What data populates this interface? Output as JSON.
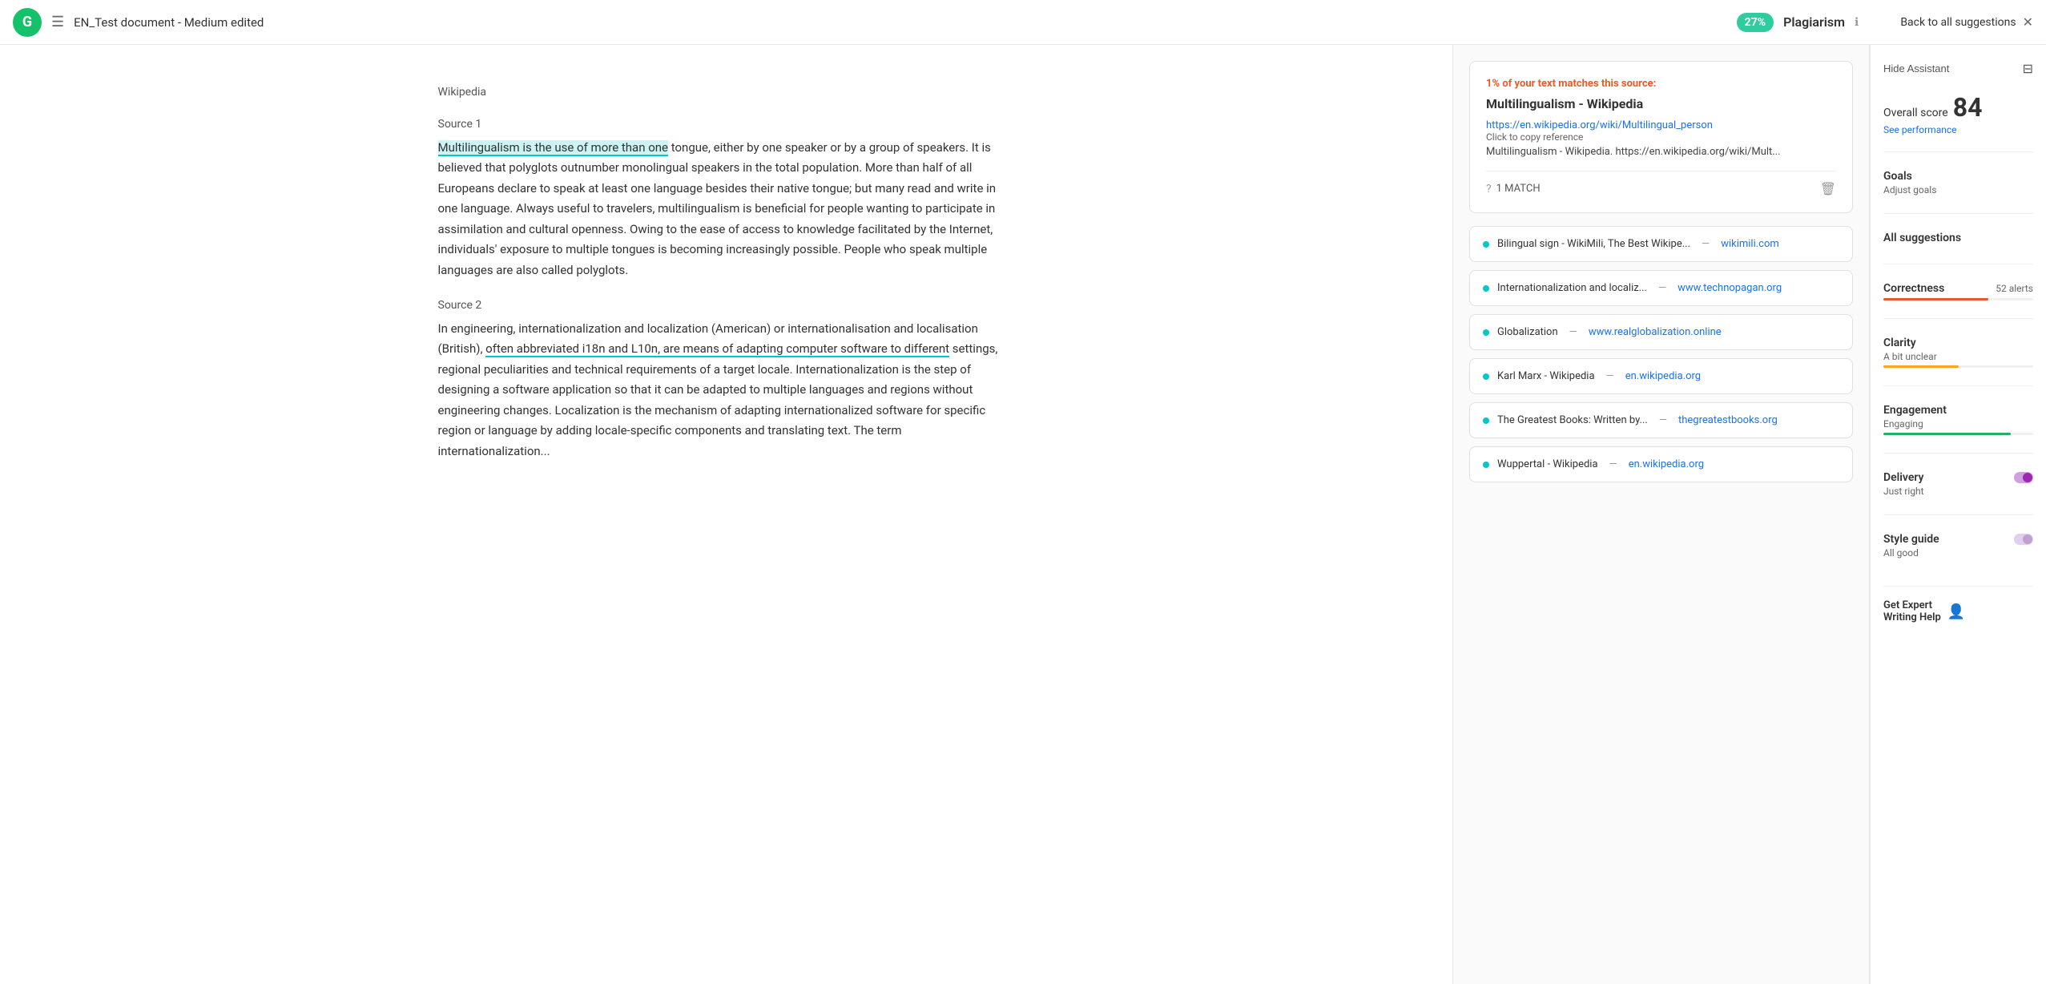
{
  "topbar": {
    "logo_text": "G",
    "menu_icon": "☰",
    "title": "EN_Test document - Medium edited",
    "plagiarism_pct": "27%",
    "plagiarism_label": "Plagiarism",
    "info_icon": "ℹ",
    "back_label": "Back to all suggestions",
    "close_icon": "✕"
  },
  "assistant": {
    "hide_label": "Hide Assistant",
    "menu_icon": "⊞",
    "overall_label": "Overall score",
    "overall_value": "84",
    "see_performance": "See performance",
    "goals_label": "Goals",
    "goals_value": "Adjust goals",
    "all_suggestions_label": "All suggestions",
    "correctness_label": "Correctness",
    "correctness_value": "52 alerts",
    "clarity_label": "Clarity",
    "clarity_value": "A bit unclear",
    "engagement_label": "Engagement",
    "engagement_value": "Engaging",
    "delivery_label": "Delivery",
    "delivery_value": "Just right",
    "style_label": "Style guide",
    "style_value": "All good",
    "expert_label": "Get Expert",
    "expert_sub": "Writing Help"
  },
  "source_card": {
    "match_pct": "1%",
    "match_text": "of your text matches this source:",
    "source_title": "Multilingualism - Wikipedia",
    "source_url": "https://en.wikipedia.org/wiki/Multilingual_person",
    "copy_ref_label": "Click to copy reference",
    "copy_ref_text": "Multilingualism - Wikipedia. https://en.wikipedia.org/wiki/Mult...",
    "match_count": "1 MATCH"
  },
  "source_list": [
    {
      "name": "Bilingual sign - WikiMili, The Best Wikipe...",
      "dash": "—",
      "domain": "wikimili.com"
    },
    {
      "name": "Internationalization and localiz...",
      "dash": "—",
      "domain": "www.technopagan.org"
    },
    {
      "name": "Globalization",
      "dash": "—",
      "domain": "www.realglobalization.online"
    },
    {
      "name": "Karl Marx - Wikipedia",
      "dash": "—",
      "domain": "en.wikipedia.org"
    },
    {
      "name": "The Greatest Books: Written by...",
      "dash": "—",
      "domain": "thegreatestbooks.org"
    },
    {
      "name": "Wuppertal - Wikipedia",
      "dash": "—",
      "domain": "en.wikipedia.org"
    }
  ],
  "editor": {
    "source1_label": "Wikipedia",
    "source1_sub": "Source 1",
    "para1": "tongue, either by one speaker or by a group of speakers. It is believed that polyglots outnumber monolingual speakers in the total population. More than half of all Europeans declare to speak at least one language besides their native tongue; but many read and write in one language. Always useful to travelers, multilingualism is beneficial for people wanting to participate in assimilation and cultural openness. Owing to the ease of access to knowledge facilitated by the Internet, individuals' exposure to multiple tongues is becoming increasingly possible. People who speak multiple languages are also called polyglots.",
    "highlight1": "Multilingualism is the use of more than one",
    "source2_label": "Source 2",
    "para2_start": "In engineering, internationalization and localization (American) or internationalisation and localisation (British), ",
    "highlight2": "often abbreviated i18n and L10n, are means of adapting computer software to different",
    "para2_end": " settings, regional peculiarities and technical requirements of a target locale. Internationalization is the step of designing a software application so that it can be adapted to multiple languages and regions without engineering changes. Localization is the mechanism of adapting internationalized software for specific region or language by adding locale-specific components and translating text. The term internationalization..."
  }
}
